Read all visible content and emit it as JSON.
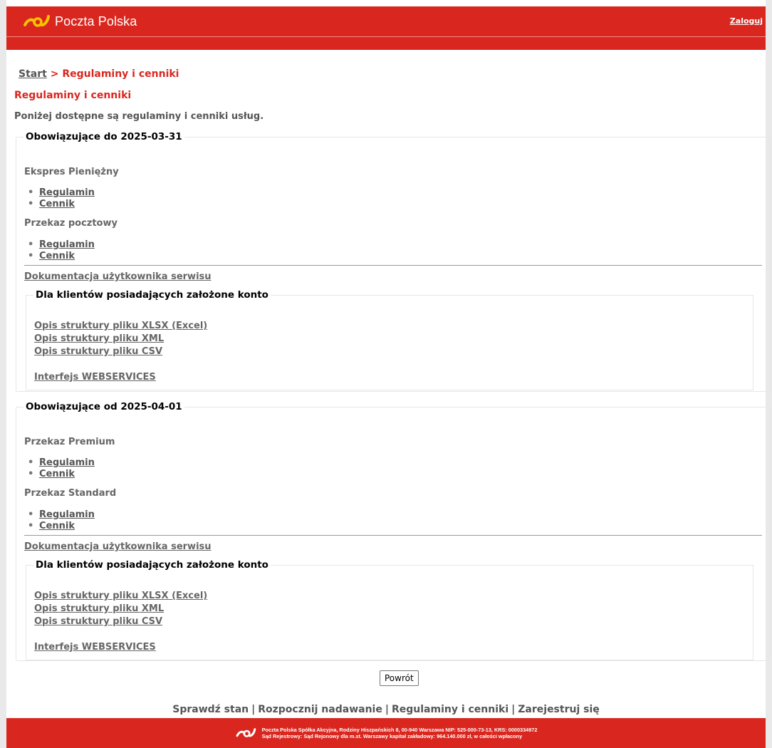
{
  "header": {
    "brand": "Poczta Polska",
    "login_label": "Zaloguj",
    "brand_color": "#d9271f",
    "logo_icon": "poczta-polska-horn-logo"
  },
  "breadcrumb": {
    "start": "Start",
    "separator": ">",
    "current": "Regulaminy i cenniki"
  },
  "page": {
    "title": "Regulaminy i cenniki",
    "intro": "Poniżej dostępne są regulaminy i cenniki usług."
  },
  "sections": [
    {
      "legend": "Obowiązujące do 2025-03-31",
      "services": [
        {
          "name": "Ekspres Pieniężny",
          "links": [
            "Regulamin",
            "Cennik"
          ]
        },
        {
          "name": "Przekaz pocztowy",
          "links": [
            "Regulamin",
            "Cennik"
          ]
        }
      ],
      "doc_link": "Dokumentacja użytkownika serwisu",
      "inner": {
        "legend": "Dla klientów posiadających założone konto",
        "links": [
          "Opis struktury pliku XLSX (Excel)",
          "Opis struktury pliku XML",
          "Opis struktury pliku CSV"
        ],
        "webservices": "Interfejs WEBSERVICES"
      }
    },
    {
      "legend": "Obowiązujące od 2025-04-01",
      "services": [
        {
          "name": "Przekaz Premium",
          "links": [
            "Regulamin",
            "Cennik"
          ]
        },
        {
          "name": "Przekaz Standard",
          "links": [
            "Regulamin",
            "Cennik"
          ]
        }
      ],
      "doc_link": "Dokumentacja użytkownika serwisu",
      "inner": {
        "legend": "Dla klientów posiadających założone konto",
        "links": [
          "Opis struktury pliku XLSX (Excel)",
          "Opis struktury pliku XML",
          "Opis struktury pliku CSV"
        ],
        "webservices": "Interfejs WEBSERVICES"
      }
    }
  ],
  "back_button": "Powrót",
  "footer": {
    "nav": [
      "Sprawdź stan",
      "Rozpocznij nadawanie",
      "Regulaminy i cenniki",
      "Zarejestruj się"
    ],
    "nav_separator": "|",
    "company_line1": "Poczta Polska Spółka Akcyjna, Rodziny Hiszpańskich 8, 00-940 Warszawa NIP: 525-000-73-13, KRS: 0000334972",
    "company_line2": "Sąd Rejestrowy: Sąd Rejonowy dla m.st. Warszawy kapitał zakładowy: 964.140.000 zł, w całości wpłacony"
  }
}
